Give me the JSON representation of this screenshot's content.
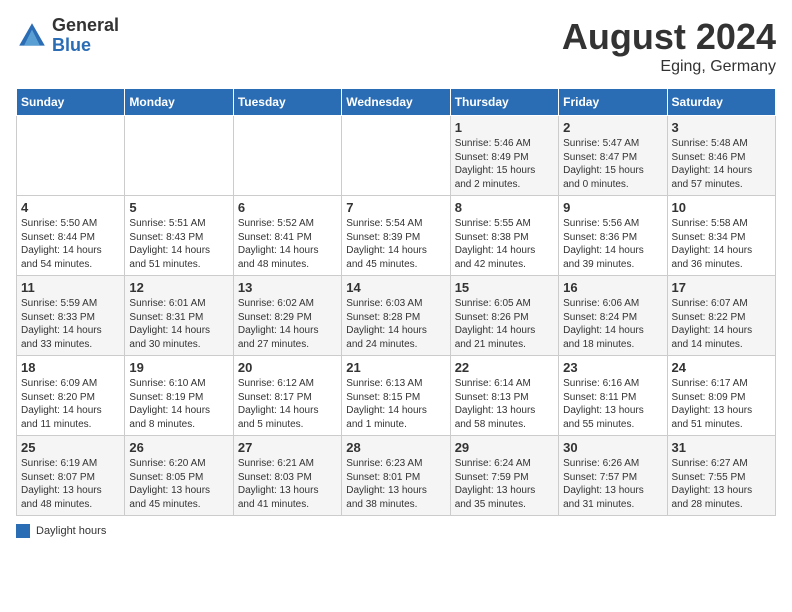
{
  "header": {
    "logo_general": "General",
    "logo_blue": "Blue",
    "month_year": "August 2024",
    "location": "Eging, Germany"
  },
  "days_of_week": [
    "Sunday",
    "Monday",
    "Tuesday",
    "Wednesday",
    "Thursday",
    "Friday",
    "Saturday"
  ],
  "legend": {
    "box_label": "Daylight hours"
  },
  "weeks": [
    [
      {
        "day": "",
        "info": ""
      },
      {
        "day": "",
        "info": ""
      },
      {
        "day": "",
        "info": ""
      },
      {
        "day": "",
        "info": ""
      },
      {
        "day": "1",
        "info": "Sunrise: 5:46 AM\nSunset: 8:49 PM\nDaylight: 15 hours\nand 2 minutes."
      },
      {
        "day": "2",
        "info": "Sunrise: 5:47 AM\nSunset: 8:47 PM\nDaylight: 15 hours\nand 0 minutes."
      },
      {
        "day": "3",
        "info": "Sunrise: 5:48 AM\nSunset: 8:46 PM\nDaylight: 14 hours\nand 57 minutes."
      }
    ],
    [
      {
        "day": "4",
        "info": "Sunrise: 5:50 AM\nSunset: 8:44 PM\nDaylight: 14 hours\nand 54 minutes."
      },
      {
        "day": "5",
        "info": "Sunrise: 5:51 AM\nSunset: 8:43 PM\nDaylight: 14 hours\nand 51 minutes."
      },
      {
        "day": "6",
        "info": "Sunrise: 5:52 AM\nSunset: 8:41 PM\nDaylight: 14 hours\nand 48 minutes."
      },
      {
        "day": "7",
        "info": "Sunrise: 5:54 AM\nSunset: 8:39 PM\nDaylight: 14 hours\nand 45 minutes."
      },
      {
        "day": "8",
        "info": "Sunrise: 5:55 AM\nSunset: 8:38 PM\nDaylight: 14 hours\nand 42 minutes."
      },
      {
        "day": "9",
        "info": "Sunrise: 5:56 AM\nSunset: 8:36 PM\nDaylight: 14 hours\nand 39 minutes."
      },
      {
        "day": "10",
        "info": "Sunrise: 5:58 AM\nSunset: 8:34 PM\nDaylight: 14 hours\nand 36 minutes."
      }
    ],
    [
      {
        "day": "11",
        "info": "Sunrise: 5:59 AM\nSunset: 8:33 PM\nDaylight: 14 hours\nand 33 minutes."
      },
      {
        "day": "12",
        "info": "Sunrise: 6:01 AM\nSunset: 8:31 PM\nDaylight: 14 hours\nand 30 minutes."
      },
      {
        "day": "13",
        "info": "Sunrise: 6:02 AM\nSunset: 8:29 PM\nDaylight: 14 hours\nand 27 minutes."
      },
      {
        "day": "14",
        "info": "Sunrise: 6:03 AM\nSunset: 8:28 PM\nDaylight: 14 hours\nand 24 minutes."
      },
      {
        "day": "15",
        "info": "Sunrise: 6:05 AM\nSunset: 8:26 PM\nDaylight: 14 hours\nand 21 minutes."
      },
      {
        "day": "16",
        "info": "Sunrise: 6:06 AM\nSunset: 8:24 PM\nDaylight: 14 hours\nand 18 minutes."
      },
      {
        "day": "17",
        "info": "Sunrise: 6:07 AM\nSunset: 8:22 PM\nDaylight: 14 hours\nand 14 minutes."
      }
    ],
    [
      {
        "day": "18",
        "info": "Sunrise: 6:09 AM\nSunset: 8:20 PM\nDaylight: 14 hours\nand 11 minutes."
      },
      {
        "day": "19",
        "info": "Sunrise: 6:10 AM\nSunset: 8:19 PM\nDaylight: 14 hours\nand 8 minutes."
      },
      {
        "day": "20",
        "info": "Sunrise: 6:12 AM\nSunset: 8:17 PM\nDaylight: 14 hours\nand 5 minutes."
      },
      {
        "day": "21",
        "info": "Sunrise: 6:13 AM\nSunset: 8:15 PM\nDaylight: 14 hours\nand 1 minute."
      },
      {
        "day": "22",
        "info": "Sunrise: 6:14 AM\nSunset: 8:13 PM\nDaylight: 13 hours\nand 58 minutes."
      },
      {
        "day": "23",
        "info": "Sunrise: 6:16 AM\nSunset: 8:11 PM\nDaylight: 13 hours\nand 55 minutes."
      },
      {
        "day": "24",
        "info": "Sunrise: 6:17 AM\nSunset: 8:09 PM\nDaylight: 13 hours\nand 51 minutes."
      }
    ],
    [
      {
        "day": "25",
        "info": "Sunrise: 6:19 AM\nSunset: 8:07 PM\nDaylight: 13 hours\nand 48 minutes."
      },
      {
        "day": "26",
        "info": "Sunrise: 6:20 AM\nSunset: 8:05 PM\nDaylight: 13 hours\nand 45 minutes."
      },
      {
        "day": "27",
        "info": "Sunrise: 6:21 AM\nSunset: 8:03 PM\nDaylight: 13 hours\nand 41 minutes."
      },
      {
        "day": "28",
        "info": "Sunrise: 6:23 AM\nSunset: 8:01 PM\nDaylight: 13 hours\nand 38 minutes."
      },
      {
        "day": "29",
        "info": "Sunrise: 6:24 AM\nSunset: 7:59 PM\nDaylight: 13 hours\nand 35 minutes."
      },
      {
        "day": "30",
        "info": "Sunrise: 6:26 AM\nSunset: 7:57 PM\nDaylight: 13 hours\nand 31 minutes."
      },
      {
        "day": "31",
        "info": "Sunrise: 6:27 AM\nSunset: 7:55 PM\nDaylight: 13 hours\nand 28 minutes."
      }
    ]
  ]
}
